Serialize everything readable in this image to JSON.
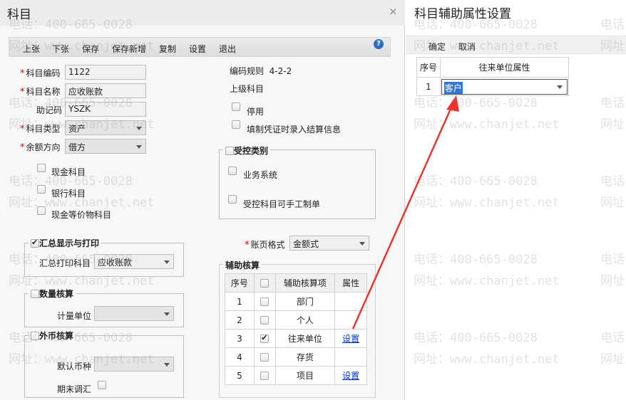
{
  "dialog": {
    "title": "科目",
    "close_glyph": "×",
    "toolbar": [
      "上张",
      "下张",
      "保存",
      "保存新增",
      "复制",
      "设置",
      "退出"
    ],
    "help_glyph": "?",
    "fields": {
      "code_label": "科目编码",
      "code_value": "1122",
      "name_label": "科目名称",
      "name_value": "应收账款",
      "mnemonic_label": "助记码",
      "mnemonic_value": "YSZK",
      "type_label": "科目类型",
      "type_value": "资产",
      "direction_label": "余额方向",
      "direction_value": "借方"
    },
    "checks": {
      "cash": "现金科目",
      "bank": "银行科目",
      "cash_equiv": "现金等价物科目"
    },
    "summary": {
      "title": "汇总显示与打印",
      "print_label": "汇总打印科目",
      "print_value": "应收账款"
    },
    "quantity": {
      "title": "数量核算",
      "unit_label": "计量单位"
    },
    "foreign": {
      "title": "外币核算",
      "currency_label": "默认币种",
      "adjust_label": "期末调汇"
    },
    "rule_label": "编码规则",
    "rule_value": "4-2-2",
    "parent_label": "上级科目",
    "disable_label": "停用",
    "settle_label": "填制凭证时录入结算信息",
    "controlled": {
      "title": "受控类别",
      "business": "业务系统",
      "manual": "受控科目可手工制单"
    },
    "ledger_label": "账页格式",
    "ledger_value": "金额式",
    "aux": {
      "title": "辅助核算",
      "headers": [
        "序号",
        "",
        "辅助核算项",
        "属性"
      ],
      "rows": [
        {
          "no": "1",
          "checked": false,
          "item": "部门",
          "attr": ""
        },
        {
          "no": "2",
          "checked": false,
          "item": "个人",
          "attr": ""
        },
        {
          "no": "3",
          "checked": true,
          "item": "往来单位",
          "attr": "设置"
        },
        {
          "no": "4",
          "checked": false,
          "item": "存货",
          "attr": ""
        },
        {
          "no": "5",
          "checked": false,
          "item": "项目",
          "attr": "设置"
        }
      ]
    }
  },
  "side": {
    "title": "科目辅助属性设置",
    "confirm": "确定",
    "cancel": "取消",
    "headers": [
      "序号",
      "往来单位属性"
    ],
    "row": {
      "no": "1",
      "value": "客户"
    }
  },
  "watermark": {
    "phone": "电话：400-665-0028",
    "site": "网址：www.chanjet.net",
    "phone_short": "电话",
    "site_short": "网址"
  },
  "colors": {
    "accent": "#2d6dc4",
    "arrow": "#e8362f",
    "link": "#0033cc",
    "required": "#dd0000"
  }
}
